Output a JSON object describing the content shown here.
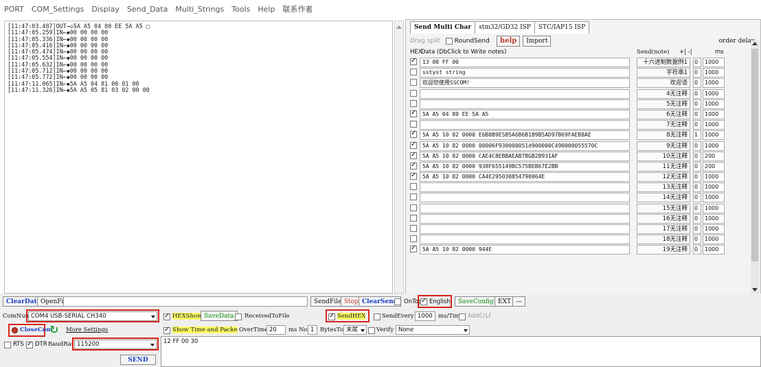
{
  "menu": [
    "PORT",
    "COM_Settings",
    "Display",
    "Send_Data",
    "Multi_Strings",
    "Tools",
    "Help",
    "联系作者"
  ],
  "log_lines": [
    "[11:47:03.487]OUT→◇5A A5 04 80 EE 5A A5 □",
    "[11:47:05.259]IN←◆00 00 00 00",
    "[11:47:05.336]IN←◆00 00 00 00",
    "[11:47:05.416]IN←◆00 00 00 00",
    "[11:47:05.474]IN←◆00 00 00 00",
    "[11:47:05.554]IN←◆00 00 00 00",
    "[11:47:05.632]IN←◆00 00 00 00",
    "[11:47:05.712]IN←◆00 00 00 00",
    "[11:47:05.772]IN←◆00 00 00 00",
    "[11:47:11.065]IN←◆5A A5 04 81 00 01 00",
    "[11:47:11.326]IN←◆5A A5 05 81 03 02 00 00"
  ],
  "multi": {
    "tabs": [
      "Send Multi Char",
      "stm32/GD32 ISP",
      "STC/IAP15 ISP"
    ],
    "drag_split": "Drag split",
    "round_send": "RoundSend",
    "help": "help",
    "import": "Import",
    "order_delay": "order delay",
    "head_hex": "HEX",
    "head_data": "Data (DbClick to Write notes)",
    "head_send": "Send(note)",
    "head_pm": "+| -|",
    "head_ms": "ms",
    "rows": [
      {
        "checked": true,
        "data": "13 00 FF 00",
        "note": "十六进制数据例1",
        "order": "0",
        "delay": "1000"
      },
      {
        "checked": false,
        "data": "sstyst string",
        "note": "字符串1",
        "order": "0",
        "delay": "1000"
      },
      {
        "checked": false,
        "data": "欢迎您使用SSCOM!",
        "note": "欢迎语",
        "order": "0",
        "delay": "1000"
      },
      {
        "checked": false,
        "data": "",
        "note": "4无注释",
        "order": "0",
        "delay": "1000"
      },
      {
        "checked": false,
        "data": "",
        "note": "5无注释",
        "order": "0",
        "delay": "1000"
      },
      {
        "checked": true,
        "data": "5A A5 04 80 EE 5A A5",
        "note": "6无注释",
        "order": "0",
        "delay": "1000"
      },
      {
        "checked": false,
        "data": "",
        "note": "7无注释",
        "order": "0",
        "delay": "1000"
      },
      {
        "checked": true,
        "data": "5A A5 10 82 0000 E6B8B9E5B5A6B6B1B9B5AD97B69FAEB8AE",
        "note": "8无注释",
        "order": "1",
        "delay": "1000"
      },
      {
        "checked": true,
        "data": "5A A5 10 82 0000 00006F930000051d900000C490000055570C",
        "note": "9无注释",
        "order": "0",
        "delay": "1000"
      },
      {
        "checked": true,
        "data": "5A A5 10 82 0000 CAE4C8EBBAEAB7BGB2B931AF",
        "note": "10无注释",
        "order": "0",
        "delay": "200"
      },
      {
        "checked": true,
        "data": "5A A5 10 82 0000 938F655149BC575BEB67E2BB",
        "note": "11无注释",
        "order": "0",
        "delay": "200"
      },
      {
        "checked": true,
        "data": "5A A5 10 82 0000 CA4E295030854790064E",
        "note": "12无注释",
        "order": "0",
        "delay": "1000"
      },
      {
        "checked": false,
        "data": "",
        "note": "13无注释",
        "order": "0",
        "delay": "1000"
      },
      {
        "checked": false,
        "data": "",
        "note": "14无注释",
        "order": "0",
        "delay": "1000"
      },
      {
        "checked": false,
        "data": "",
        "note": "15无注释",
        "order": "0",
        "delay": "1000"
      },
      {
        "checked": false,
        "data": "",
        "note": "16无注释",
        "order": "0",
        "delay": "1000"
      },
      {
        "checked": false,
        "data": "",
        "note": "17无注释",
        "order": "0",
        "delay": "1000"
      },
      {
        "checked": false,
        "data": "",
        "note": "18无注释",
        "order": "0",
        "delay": "1000"
      },
      {
        "checked": true,
        "data": "5A A5 10 82 0000 944E",
        "note": "19无注释",
        "order": "0",
        "delay": "1000"
      }
    ]
  },
  "bottom": {
    "clear_data": "ClearData",
    "open_file": "OpenFile",
    "send_file": "SendFile",
    "stop": "Stop",
    "clear_send": "ClearSend",
    "on_top": "OnTop",
    "english": "English",
    "save_config": "SaveConfig",
    "ext": "EXT",
    "minus": "—",
    "com_num_label": "ComNum",
    "com_num_value": "COM4 USB-SERIAL CH340",
    "hex_show": "HEXShow",
    "save_data": "SaveData",
    "received_to_file": "ReceivedToFile",
    "send_hex": "SendHEX",
    "send_every": "SendEvery",
    "send_every_value": "1000",
    "ms_tim": "ms/Tim",
    "add_crlf": "AddCrLf",
    "close_com": "CloseCom",
    "more_settings": "More Settings",
    "show_time": "Show Time and Packe",
    "overtime": "OverTime",
    "overtime_value": "20",
    "ms_no": "ms No",
    "no_value": "1",
    "bytes_to": "BytesTo",
    "bytes_to_value": "末尾",
    "verify": "Verify",
    "verify_value": "None",
    "rts": "RTS",
    "dtr": "DTR",
    "baud_label": "BaudRat",
    "baud_value": "115200",
    "send_text": "12 FF 00 30",
    "send_btn": "SEND"
  }
}
